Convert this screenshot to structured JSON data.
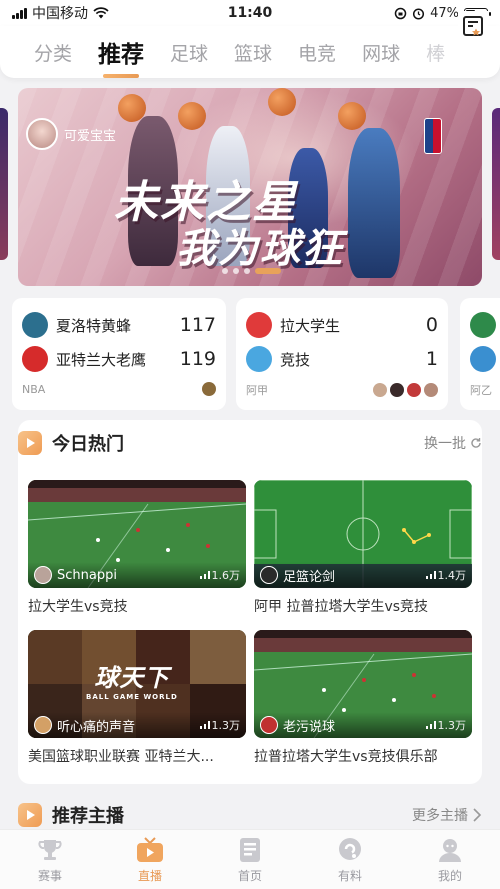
{
  "status_bar": {
    "carrier": "中国移动",
    "time": "11:40",
    "battery": "47%",
    "battery_level": 0.47
  },
  "tabs": [
    {
      "label": "分类",
      "active": false
    },
    {
      "label": "推荐",
      "active": true
    },
    {
      "label": "足球",
      "active": false
    },
    {
      "label": "篮球",
      "active": false
    },
    {
      "label": "电竞",
      "active": false
    },
    {
      "label": "网球",
      "active": false
    },
    {
      "label": "棒",
      "active": false
    }
  ],
  "banner": {
    "user": "可爱宝宝",
    "title_line1": "未来之星",
    "title_line2": "我为球狂",
    "slide_index": 3,
    "slide_count": 4
  },
  "matches": [
    {
      "league": "NBA",
      "teams": [
        {
          "name": "夏洛特黄蜂",
          "score": "117",
          "color": "#2c6f8e"
        },
        {
          "name": "亚特兰大老鹰",
          "score": "119",
          "color": "#d62b2b"
        }
      ]
    },
    {
      "league": "阿甲",
      "teams": [
        {
          "name": "拉大学生",
          "score": "0",
          "color": "#e03a3a"
        },
        {
          "name": "竞技",
          "score": "1",
          "color": "#4aa7e0"
        }
      ]
    },
    {
      "league": "阿乙",
      "teams": [
        {
          "name": "",
          "score": "",
          "color": "#2e8a4a"
        },
        {
          "name": "",
          "score": "",
          "color": "#3a8fd0"
        }
      ]
    }
  ],
  "hot": {
    "title": "今日热门",
    "action": "换一批",
    "videos": [
      {
        "streamer": "Schnappi",
        "views": "1.6万",
        "title": "拉大学生vs竞技",
        "thumb": "football"
      },
      {
        "streamer": "足篮论剑",
        "views": "1.4万",
        "title": "阿甲 拉普拉塔大学生vs竞技",
        "thumb": "tactics"
      },
      {
        "streamer": "听心痛的声音",
        "views": "1.3万",
        "title": "美国篮球职业联赛 亚特兰大...",
        "thumb": "basketball",
        "logo": "球天下",
        "logo_sub": "BALL GAME WORLD"
      },
      {
        "streamer": "老污说球",
        "views": "1.3万",
        "title": "拉普拉塔大学生vs竞技俱乐部",
        "thumb": "football"
      }
    ]
  },
  "anchors": {
    "title": "推荐主播",
    "action": "更多主播"
  },
  "bottom_nav": [
    {
      "label": "赛事",
      "icon": "trophy-icon",
      "active": false
    },
    {
      "label": "直播",
      "icon": "tv-icon",
      "active": true
    },
    {
      "label": "首页",
      "icon": "document-icon",
      "active": false
    },
    {
      "label": "有料",
      "icon": "chat-icon",
      "active": false
    },
    {
      "label": "我的",
      "icon": "profile-icon",
      "active": false
    }
  ],
  "colors": {
    "accent": "#e89a55",
    "tab_inactive": "#a4a4a8",
    "background": "#f2f2f4"
  }
}
